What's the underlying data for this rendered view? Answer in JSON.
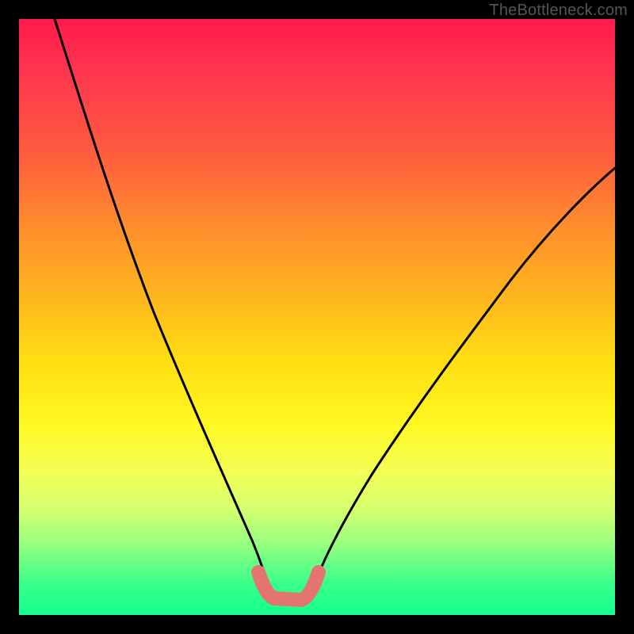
{
  "watermark": "TheBottleneck.com",
  "chart_data": {
    "type": "line",
    "title": "",
    "xlabel": "",
    "ylabel": "",
    "xlim": [
      0,
      100
    ],
    "ylim": [
      0,
      100
    ],
    "grid": false,
    "legend": false,
    "series": [
      {
        "name": "left-curve",
        "x": [
          6,
          10,
          15,
          20,
          25,
          30,
          35,
          38,
          40,
          41.5
        ],
        "y": [
          100,
          85,
          67,
          52,
          39,
          27,
          17,
          10,
          6,
          4
        ]
      },
      {
        "name": "right-curve",
        "x": [
          49,
          52,
          58,
          65,
          73,
          82,
          90,
          100
        ],
        "y": [
          4,
          9,
          18,
          28,
          40,
          53,
          63,
          75
        ]
      },
      {
        "name": "bottom-red-segment",
        "x": [
          40,
          41,
          42.5,
          45,
          47.5,
          49,
          50
        ],
        "y": [
          7,
          4,
          2.5,
          2.4,
          2.6,
          4,
          7
        ]
      }
    ],
    "colors": {
      "curve": "#000000",
      "bottom_segment": "#e4746f",
      "gradient_top": "#ff1a4b",
      "gradient_mid": "#ffe012",
      "gradient_bottom": "#14ff8f"
    }
  }
}
